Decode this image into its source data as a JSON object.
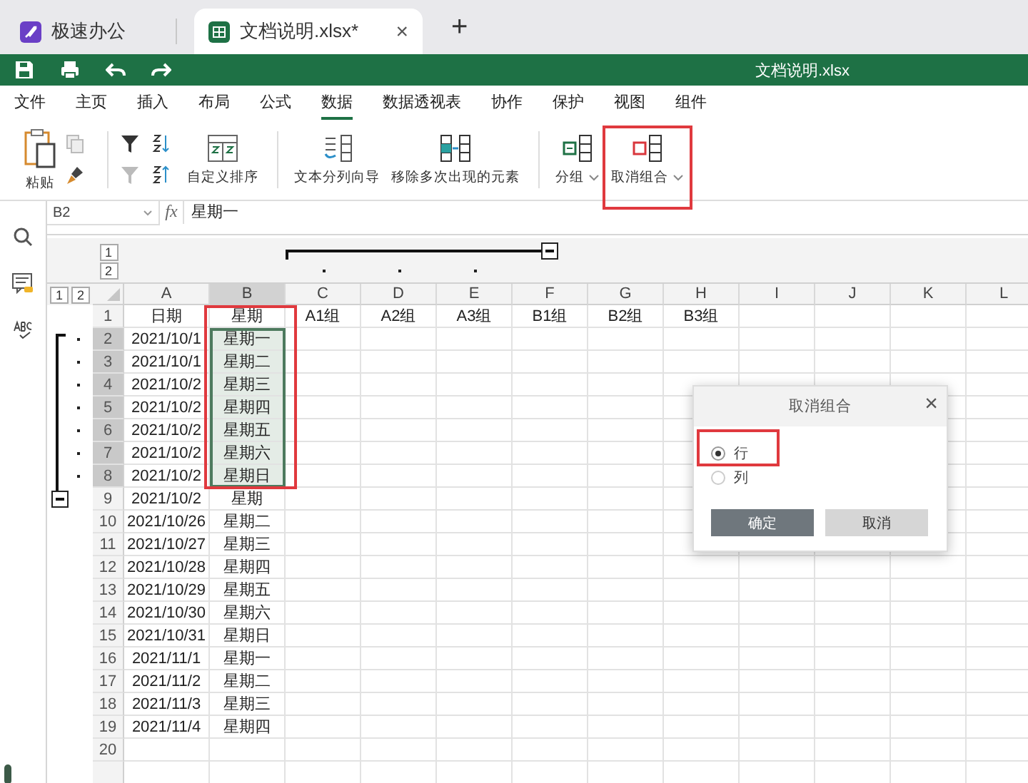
{
  "app_tabs": [
    {
      "kind": "home",
      "label": "极速办公",
      "selected": false
    },
    {
      "kind": "sheet",
      "label": "文档说明.xlsx*",
      "selected": true,
      "close": "×"
    }
  ],
  "new_tab": "+",
  "title_bar": {
    "title": "文档说明.xlsx"
  },
  "menu": [
    {
      "label": "文件",
      "selected": false
    },
    {
      "label": "主页",
      "selected": false
    },
    {
      "label": "插入",
      "selected": false
    },
    {
      "label": "布局",
      "selected": false
    },
    {
      "label": "公式",
      "selected": false
    },
    {
      "label": "数据",
      "selected": true
    },
    {
      "label": "数据透视表",
      "selected": false
    },
    {
      "label": "协作",
      "selected": false
    },
    {
      "label": "保护",
      "selected": false
    },
    {
      "label": "视图",
      "selected": false
    },
    {
      "label": "组件",
      "selected": false
    }
  ],
  "ribbon": [
    {
      "kind": "paste",
      "label": "粘贴"
    },
    {
      "kind": "copy-tools"
    },
    {
      "kind": "separator"
    },
    {
      "kind": "filter"
    },
    {
      "kind": "sort"
    },
    {
      "kind": "custom-sort",
      "label": "自定义排序"
    },
    {
      "kind": "separator"
    },
    {
      "kind": "split",
      "label": "文本分列向导"
    },
    {
      "kind": "dedupe",
      "label": "移除多次出现的元素"
    },
    {
      "kind": "separator"
    },
    {
      "kind": "group",
      "label": "分组",
      "dropdown": true
    },
    {
      "kind": "ungroup",
      "label": "取消组合",
      "dropdown": true
    }
  ],
  "formula_bar": {
    "cell_ref": "B2",
    "fx": "fx",
    "value": "星期一"
  },
  "outline": {
    "column_levels": [
      "1",
      "2"
    ],
    "row_levels": [
      "1",
      "2"
    ],
    "column_group_expanded": true,
    "row_group_expanded": true
  },
  "sheet": {
    "columns": [
      {
        "label": "A",
        "selected": false,
        "grouped": false
      },
      {
        "label": "B",
        "selected": true,
        "grouped": false
      },
      {
        "label": "C",
        "selected": false,
        "grouped": true
      },
      {
        "label": "D",
        "selected": false,
        "grouped": true
      },
      {
        "label": "E",
        "selected": false,
        "grouped": true
      },
      {
        "label": "F",
        "selected": false,
        "grouped": false
      },
      {
        "label": "G",
        "selected": false,
        "grouped": false
      },
      {
        "label": "H",
        "selected": false,
        "grouped": false
      },
      {
        "label": "I",
        "selected": false,
        "grouped": false
      },
      {
        "label": "J",
        "selected": false,
        "grouped": false
      },
      {
        "label": "K",
        "selected": false,
        "grouped": false
      },
      {
        "label": "L",
        "selected": false,
        "grouped": false
      }
    ],
    "rows": [
      {
        "label": "1",
        "selected": false,
        "grouped": false,
        "cells": [
          "日期",
          "星期",
          "A1组",
          "A2组",
          "A3组",
          "B1组",
          "B2组",
          "B3组"
        ]
      },
      {
        "label": "2",
        "selected": true,
        "grouped": true,
        "cells": [
          "2021/10/1",
          "星期一"
        ]
      },
      {
        "label": "3",
        "selected": true,
        "grouped": true,
        "cells": [
          "2021/10/1",
          "星期二"
        ]
      },
      {
        "label": "4",
        "selected": true,
        "grouped": true,
        "cells": [
          "2021/10/2",
          "星期三"
        ]
      },
      {
        "label": "5",
        "selected": true,
        "grouped": true,
        "cells": [
          "2021/10/2",
          "星期四"
        ]
      },
      {
        "label": "6",
        "selected": true,
        "grouped": true,
        "cells": [
          "2021/10/2",
          "星期五"
        ]
      },
      {
        "label": "7",
        "selected": true,
        "grouped": true,
        "cells": [
          "2021/10/2",
          "星期六"
        ]
      },
      {
        "label": "8",
        "selected": true,
        "grouped": true,
        "cells": [
          "2021/10/2",
          "星期日"
        ]
      },
      {
        "label": "9",
        "selected": false,
        "grouped": false,
        "cells": [
          "2021/10/2",
          "星期"
        ]
      },
      {
        "label": "10",
        "selected": false,
        "grouped": false,
        "cells": [
          "2021/10/26",
          "星期二"
        ]
      },
      {
        "label": "11",
        "selected": false,
        "grouped": false,
        "cells": [
          "2021/10/27",
          "星期三"
        ]
      },
      {
        "label": "12",
        "selected": false,
        "grouped": false,
        "cells": [
          "2021/10/28",
          "星期四"
        ]
      },
      {
        "label": "13",
        "selected": false,
        "grouped": false,
        "cells": [
          "2021/10/29",
          "星期五"
        ]
      },
      {
        "label": "14",
        "selected": false,
        "grouped": false,
        "cells": [
          "2021/10/30",
          "星期六"
        ]
      },
      {
        "label": "15",
        "selected": false,
        "grouped": false,
        "cells": [
          "2021/10/31",
          "星期日"
        ]
      },
      {
        "label": "16",
        "selected": false,
        "grouped": false,
        "cells": [
          "2021/11/1",
          "星期一"
        ]
      },
      {
        "label": "17",
        "selected": false,
        "grouped": false,
        "cells": [
          "2021/11/2",
          "星期二"
        ]
      },
      {
        "label": "18",
        "selected": false,
        "grouped": false,
        "cells": [
          "2021/11/3",
          "星期三"
        ]
      },
      {
        "label": "19",
        "selected": false,
        "grouped": false,
        "cells": [
          "2021/11/4",
          "星期四"
        ]
      },
      {
        "label": "20",
        "selected": false,
        "grouped": false,
        "cells": []
      }
    ]
  },
  "dialog": {
    "title": "取消组合",
    "close": "×",
    "options": [
      {
        "label": "行",
        "selected": true
      },
      {
        "label": "列",
        "selected": false
      }
    ],
    "buttons": [
      {
        "label": "确定",
        "kind": "primary"
      },
      {
        "label": "取消",
        "kind": "secondary"
      }
    ]
  }
}
